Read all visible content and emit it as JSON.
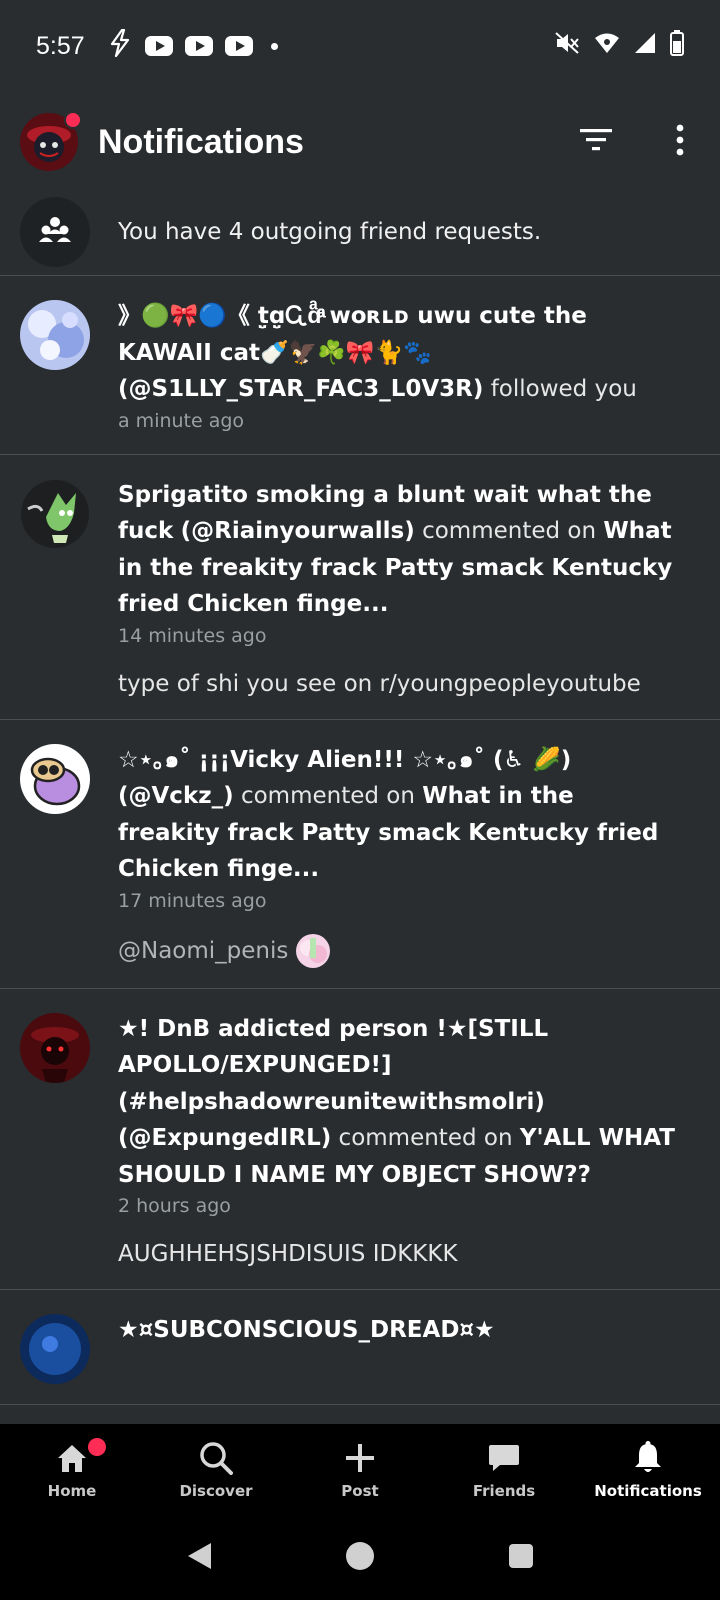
{
  "status_bar": {
    "time": "5:57",
    "left_icons": [
      "flash-icon",
      "youtube-icon",
      "youtube-icon",
      "youtube-icon",
      "dot-icon"
    ],
    "right_icons": [
      "mute-icon",
      "wifi-icon",
      "signal-icon",
      "battery-icon"
    ]
  },
  "header": {
    "title": "Notifications",
    "filter_icon": "filter-icon",
    "more_icon": "more-vertical-icon"
  },
  "friend_requests": {
    "text": "You have 4 outgoing friend requests."
  },
  "notifications": [
    {
      "name": "》🟢🎀🔵《 t̤̮ɑ̤̮Ꮹɑͣͣͣͣͣͣͣͣ ᴡᴏʀʟᴅ uwu cute the KAWAII cat🍼🦅☘️🎀🐈🐾",
      "handle": "(@S1LLY_STAR_FAC3_L0V3R)",
      "action": " followed you",
      "target": "",
      "time": "a minute ago",
      "preview": ""
    },
    {
      "name": "Sprigatito smoking a blunt wait what the fuck",
      "handle": "(@Riainyourwalls)",
      "action": " commented on ",
      "target": "What in the freakity frack Patty smack Kentucky fried Chicken finge...",
      "time": "14 minutes ago",
      "preview": "type of shi you see on r/youngpeopleyoutube"
    },
    {
      "name": "☆⋆｡๑˚ ¡¡¡Vicky Alien!!! ☆⋆｡๑˚ (♿ 🌽)",
      "handle": "(@Vckz_)",
      "action": " commented on ",
      "target": "What in the freakity frack Patty smack Kentucky fried Chicken finge...",
      "time": "17 minutes ago",
      "preview": "@Naomi_penis"
    },
    {
      "name": "★! DnB addicted person !★[STILL APOLLO/EXPUNGED!] (#helpshadowreunitewithsmolri)",
      "handle": "(@ExpungedIRL)",
      "action": " commented on ",
      "target": "Y'ALL WHAT SHOULD I NAME MY OBJECT SHOW??",
      "time": "2 hours ago",
      "preview": "AUGHHEHSJSHDISUIS IDKKKK"
    },
    {
      "name": "★¤SUBCONSCIOUS_DREAD¤★",
      "handle": "",
      "action": "",
      "target": "",
      "time": "",
      "preview": ""
    }
  ],
  "bottom_nav": {
    "items": [
      {
        "label": "Home",
        "icon": "home-icon"
      },
      {
        "label": "Discover",
        "icon": "search-icon"
      },
      {
        "label": "Post",
        "icon": "plus-icon"
      },
      {
        "label": "Friends",
        "icon": "chat-icon"
      },
      {
        "label": "Notifications",
        "icon": "bell-icon"
      }
    ],
    "active": "Notifications"
  },
  "system_nav": [
    "back-icon",
    "home-circle-icon",
    "recents-icon"
  ],
  "colors": {
    "background": "#292d2f",
    "nav_background": "#000000",
    "badge": "#ff2d55",
    "muted_text": "#9a9fa2"
  }
}
